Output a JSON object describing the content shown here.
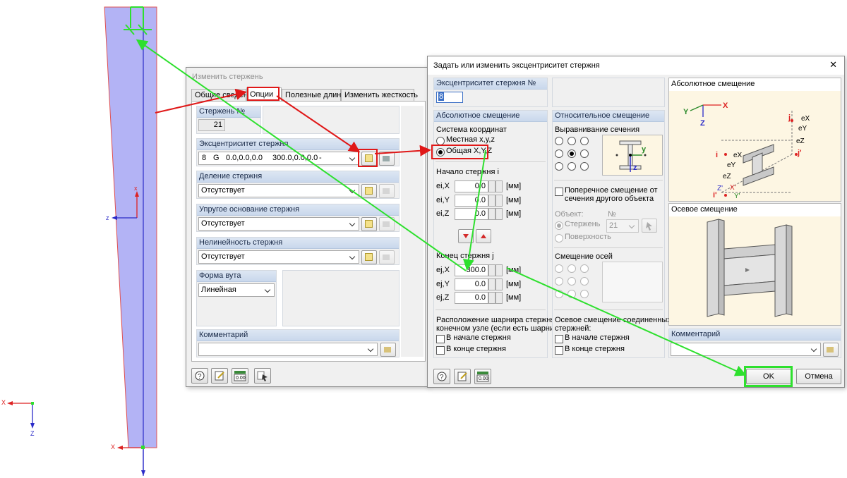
{
  "axes": {
    "x_label": "X",
    "z_label": "Z",
    "member_x_label": "x",
    "member_z_label": "z",
    "lower_x_label": "X"
  },
  "edit_member": {
    "title": "Изменить стержень",
    "tabs": [
      "Общие сведения",
      "Опции",
      "Полезные длины",
      "Изменить жесткость"
    ],
    "member_no_label": "Стержень №",
    "member_no_value": "21",
    "eccentricity_label": "Эксцентриситет стержня",
    "eccentricity_value": [
      "8",
      "G",
      "0.0,0.0,0.0",
      "300.0,0.0,0.0",
      "-"
    ],
    "division_label": "Деление стержня",
    "division_value": "Отсутствует",
    "elastic_label": "Упругое основание стержня",
    "elastic_value": "Отсутствует",
    "nonlinearity_label": "Нелинейность стержня",
    "nonlinearity_value": "Отсутствует",
    "taper_label": "Форма вута",
    "taper_value": "Линейная",
    "comment_label": "Комментарий"
  },
  "ecc_dialog": {
    "title": "Задать или изменить эксцентриситет стержня",
    "close_glyph": "✕",
    "ecc_no_label": "Эксцентриситет стержня №",
    "ecc_no_value": "8",
    "absolute_label": "Абсолютное смещение",
    "coord_system_label": "Система координат",
    "local_label": "Местная x,y,z",
    "global_label": "Общая X,Y,Z",
    "start_label": "Начало стержня  i",
    "end_label": "Конец стержня  j",
    "start_rows": [
      {
        "label": "ei,X",
        "value": "0.0",
        "unit": "[мм]"
      },
      {
        "label": "ei,Y",
        "value": "0.0",
        "unit": "[мм]"
      },
      {
        "label": "ei,Z",
        "value": "0.0",
        "unit": "[мм]"
      }
    ],
    "end_rows": [
      {
        "label": "ej,X",
        "value": "300.0",
        "unit": "[мм]"
      },
      {
        "label": "ej,Y",
        "value": "0.0",
        "unit": "[мм]"
      },
      {
        "label": "ej,Z",
        "value": "0.0",
        "unit": "[мм]"
      }
    ],
    "hinge_text_1": "Расположение шарнира стержня в",
    "hinge_text_2": "конечном узле (если есть шарнир)",
    "at_start": "В начале стержня",
    "at_end": "В конце стержня",
    "relative_label": "Относительное смещение",
    "alignment_label": "Выравнивание сечения",
    "transverse_1": "Поперечное смещение от",
    "transverse_2": "сечения другого объекта",
    "object_label": "Объект:",
    "no_label": "№",
    "member_opt": "Стержень",
    "surface_opt": "Поверхность",
    "object_no": "21",
    "axis_offset_label": "Смещение осей",
    "axial_1": "Осевое смещение соединенных",
    "axial_2": "стержней:",
    "abs_offset_title": "Абсолютное смещение",
    "axial_offset_title": "Осевое смещение",
    "comment_label": "Комментарий",
    "ok": "OK",
    "cancel": "Отмена",
    "diag_labels": {
      "x": "X",
      "y": "Y",
      "z": "Z",
      "ex": "eX",
      "ey": "eY",
      "ez": "eZ",
      "i": "i",
      "j": "j",
      "ip": "i'",
      "jp": "j'",
      "zp": "Z'",
      "yp": "Y'",
      "xp": "X'"
    },
    "section_axes": {
      "y": "y",
      "z": "z"
    }
  },
  "colors": {
    "red_callout": "#e01818",
    "green_callout": "#2ee02e",
    "member_fill": "#b3b3f5",
    "panel_head": "#c9d8ec"
  }
}
